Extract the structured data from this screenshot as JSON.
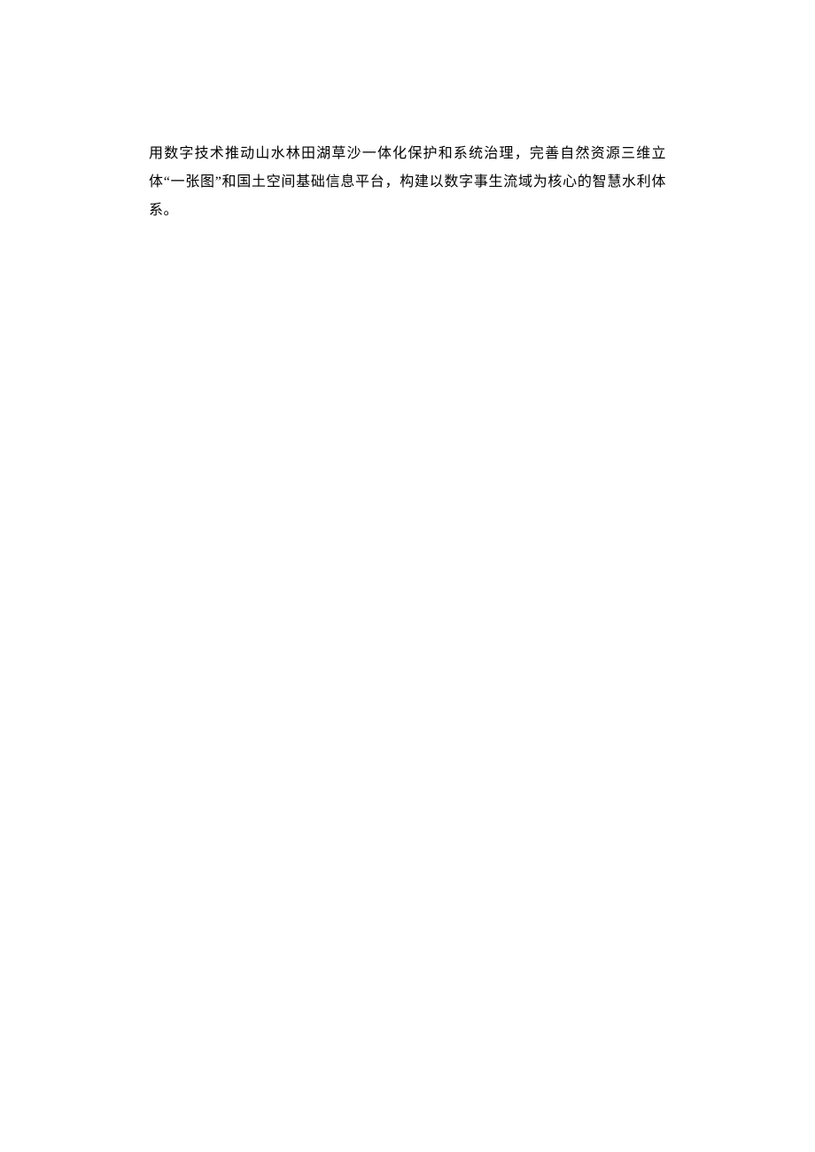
{
  "document": {
    "paragraph": "用数字技术推动山水林田湖草沙一体化保护和系统治理，完善自然资源三维立体“一张图”和国土空间基础信息平台，构建以数字事生流域为核心的智慧水利体系。"
  }
}
